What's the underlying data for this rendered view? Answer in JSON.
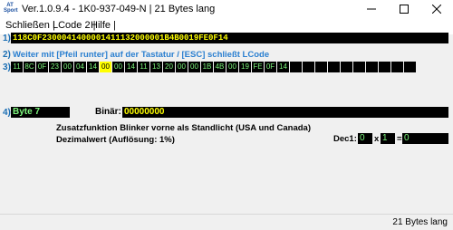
{
  "window": {
    "app_icon_text_top": "AT",
    "app_icon_text_bottom": "Sport",
    "title": "Ver.1.0.9.4 -    1K0-937-049-N | 21 Bytes lang"
  },
  "menu": [
    "Schließen |",
    "LCode 2 |",
    "Hilfe |"
  ],
  "row_numbers": [
    "1)",
    "2)",
    "3)",
    "4)"
  ],
  "hex_string": "118C0F2300041400001411132000001B4B0019FE0F14",
  "hint_text": "Weiter mit [Pfeil runter] auf der Tastatur / [ESC] schließt LCode",
  "bytes": [
    "11",
    "8C",
    "0F",
    "23",
    "00",
    "04",
    "14",
    "00",
    "00",
    "14",
    "11",
    "13",
    "20",
    "00",
    "00",
    "1B",
    "4B",
    "00",
    "19",
    "FE",
    "0F",
    "14",
    "",
    "",
    "",
    "",
    "",
    "",
    "",
    "",
    "",
    ""
  ],
  "selected_byte_index": 7,
  "byte_label": "Byte 7",
  "binary_label": "Binär:",
  "binary_value": "00000000",
  "description_line1": "Zusatzfunktion Blinker vorne als Standlicht (USA und Canada)",
  "description_line2": "Dezimalwert (Auflösung: 1%)",
  "decimal": {
    "label": "Dec1:",
    "value": "0",
    "times_symbol": "x",
    "factor": "1",
    "equals_symbol": "=",
    "result": "0"
  },
  "status_text": "21 Bytes lang",
  "colors": {
    "row_number": "#1c6fb4",
    "hint": "#2a7fd0",
    "hex_text": "#ffff00",
    "cell_text": "#7df57d",
    "selected_cell": "#ffff00"
  }
}
